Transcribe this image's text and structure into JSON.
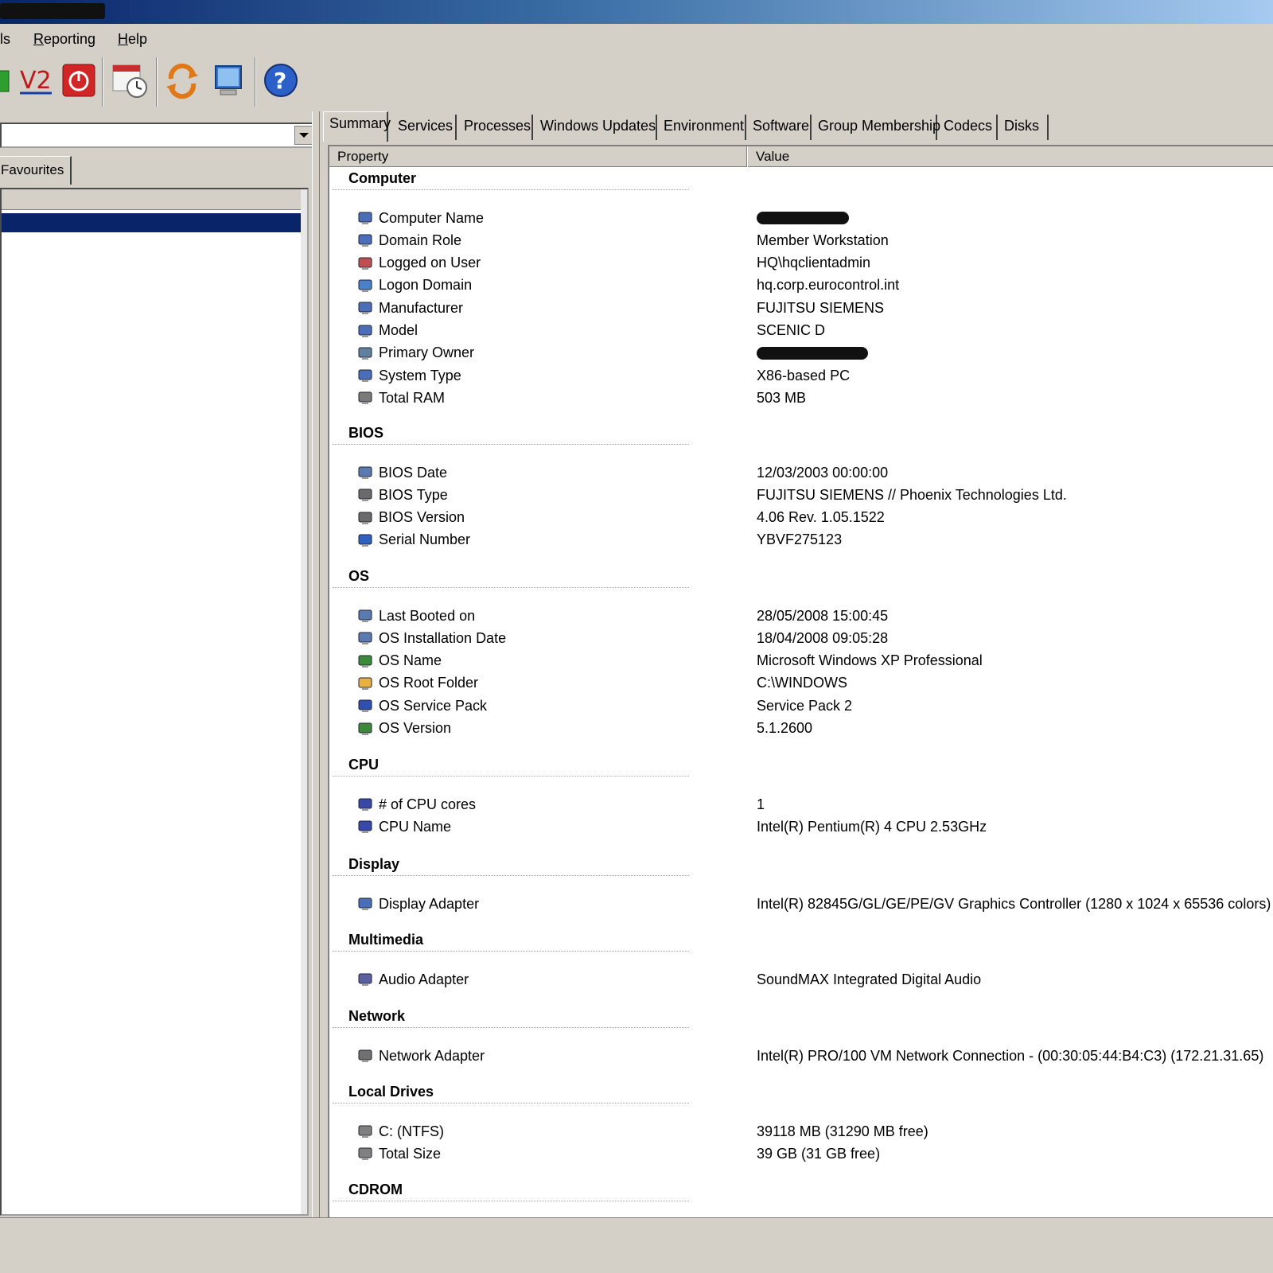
{
  "menu": {
    "tools_fragment": "ls",
    "reporting": "Reporting",
    "reporting_underline": "R",
    "reporting_rest": "eporting",
    "help_underline": "H",
    "help_rest": "elp"
  },
  "toolbar": {
    "icons": [
      "green-shape-icon",
      "vnc-icon",
      "power-icon",
      "calendar-clock-icon",
      "refresh-icon",
      "monitor-icon",
      "help-icon"
    ],
    "vnc_label": "V2"
  },
  "left_pane": {
    "favourites_tab": "Favourites"
  },
  "tabs": [
    "Summary",
    "Services",
    "Processes",
    "Windows Updates",
    "Environment",
    "Software",
    "Group Membership",
    "Codecs",
    "Disks"
  ],
  "grid": {
    "col_property": "Property",
    "col_value": "Value",
    "sections": [
      {
        "title": "Computer",
        "rows": [
          {
            "prop": "Computer Name",
            "value": "",
            "icon": "computer-icon",
            "redacted": true
          },
          {
            "prop": "Domain Role",
            "value": "Member Workstation",
            "icon": "computer-icon"
          },
          {
            "prop": "Logged on User",
            "value": "HQ\\hqclientadmin",
            "icon": "users-icon"
          },
          {
            "prop": "Logon Domain",
            "value": "hq.corp.eurocontrol.int",
            "icon": "network-icon"
          },
          {
            "prop": "Manufacturer",
            "value": "FUJITSU SIEMENS",
            "icon": "computer-icon"
          },
          {
            "prop": "Model",
            "value": "SCENIC D",
            "icon": "computer-icon"
          },
          {
            "prop": "Primary Owner",
            "value": "",
            "icon": "owner-icon",
            "redacted": true
          },
          {
            "prop": "System Type",
            "value": "X86-based PC",
            "icon": "computer-icon"
          },
          {
            "prop": "Total RAM",
            "value": "503 MB",
            "icon": "memory-icon"
          }
        ]
      },
      {
        "title": "BIOS",
        "rows": [
          {
            "prop": "BIOS Date",
            "value": "12/03/2003 00:00:00",
            "icon": "date-icon"
          },
          {
            "prop": "BIOS Type",
            "value": "FUJITSU SIEMENS // Phoenix Technologies Ltd.",
            "icon": "chip-icon"
          },
          {
            "prop": "BIOS Version",
            "value": "4.06  Rev. 1.05.1522",
            "icon": "chip-icon"
          },
          {
            "prop": "Serial Number",
            "value": "YBVF275123",
            "icon": "info-icon"
          }
        ]
      },
      {
        "title": "OS",
        "rows": [
          {
            "prop": "Last Booted on",
            "value": "28/05/2008 15:00:45",
            "icon": "date-icon"
          },
          {
            "prop": "OS Installation Date",
            "value": "18/04/2008 09:05:28",
            "icon": "date-icon"
          },
          {
            "prop": "OS Name",
            "value": "Microsoft Windows XP Professional",
            "icon": "windows-icon"
          },
          {
            "prop": "OS Root Folder",
            "value": "C:\\WINDOWS",
            "icon": "folder-icon"
          },
          {
            "prop": "OS Service Pack",
            "value": "Service Pack 2",
            "icon": "service-pack-icon"
          },
          {
            "prop": "OS Version",
            "value": "5.1.2600",
            "icon": "windows-icon"
          }
        ]
      },
      {
        "title": "CPU",
        "rows": [
          {
            "prop": "# of CPU cores",
            "value": "1",
            "icon": "cpu-icon"
          },
          {
            "prop": "CPU Name",
            "value": "Intel(R) Pentium(R) 4 CPU 2.53GHz",
            "icon": "cpu-icon"
          }
        ]
      },
      {
        "title": "Display",
        "rows": [
          {
            "prop": "Display Adapter",
            "value": "Intel(R) 82845G/GL/GE/PE/GV Graphics Controller (1280 x 1024 x 65536 colors)",
            "icon": "display-icon"
          }
        ]
      },
      {
        "title": "Multimedia",
        "rows": [
          {
            "prop": "Audio Adapter",
            "value": "SoundMAX Integrated Digital Audio",
            "icon": "audio-icon"
          }
        ]
      },
      {
        "title": "Network",
        "rows": [
          {
            "prop": "Network Adapter",
            "value": "Intel(R) PRO/100 VM Network Connection -  (00:30:05:44:B4:C3)  (172.21.31.65)",
            "icon": "network-card-icon"
          }
        ]
      },
      {
        "title": "Local Drives",
        "rows": [
          {
            "prop": "C: (NTFS)",
            "value": "39118 MB (31290 MB free)",
            "icon": "drive-icon"
          },
          {
            "prop": "Total Size",
            "value": "39 GB (31 GB free)",
            "icon": "drive-icon"
          }
        ]
      },
      {
        "title": "CDROM",
        "rows": []
      }
    ]
  }
}
